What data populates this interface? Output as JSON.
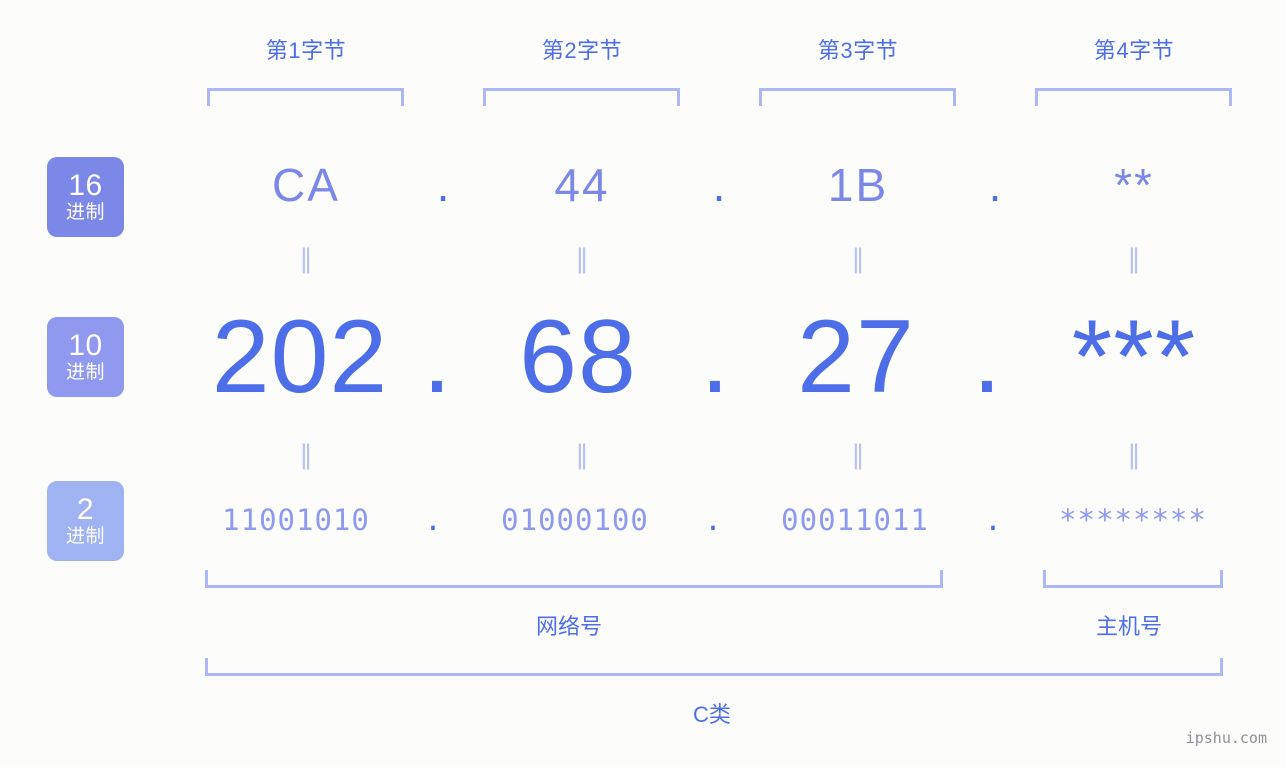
{
  "background_color": "#fcfdfa",
  "accent_color": "#4d6ee8",
  "accent_light": "#7b88e8",
  "bracket_color": "#aeb7f5",
  "byte_headers": [
    {
      "label": "第1字节"
    },
    {
      "label": "第2字节"
    },
    {
      "label": "第3字节"
    },
    {
      "label": "第4字节"
    }
  ],
  "radix_badges": [
    {
      "number": "16",
      "unit": "进制",
      "color": "#7b88e8"
    },
    {
      "number": "10",
      "unit": "进制",
      "color": "#8e99ef"
    },
    {
      "number": "2",
      "unit": "进制",
      "color": "#9fb3f2"
    }
  ],
  "rows": {
    "hex": {
      "values": [
        "CA",
        "44",
        "1B",
        "**"
      ],
      "separator": "."
    },
    "decimal": {
      "values": [
        "202",
        "68",
        "27",
        "***"
      ],
      "separator": "."
    },
    "binary": {
      "values": [
        "11001010",
        "01000100",
        "00011011",
        "********"
      ],
      "separator": "."
    }
  },
  "equals_symbol": "‖",
  "sections": {
    "network": "网络号",
    "host": "主机号",
    "class": "C类"
  },
  "watermark": "ipshu.com"
}
